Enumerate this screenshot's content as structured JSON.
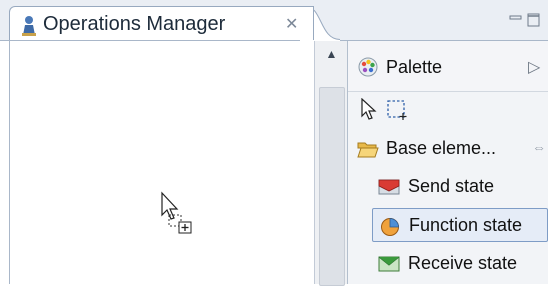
{
  "tab": {
    "title": "Operations Manager",
    "icon": "person-icon",
    "close_glyph": "✕"
  },
  "window_controls": [
    "minimize-icon",
    "maximize-icon"
  ],
  "scrollbar": {
    "up_glyph": "▲"
  },
  "palette": {
    "title": "Palette",
    "icon": "palette-icon",
    "collapse_glyph": "▷",
    "tools": [
      "select-arrow-icon",
      "marquee-select-icon"
    ],
    "drawer": {
      "label": "Base eleme...",
      "icon": "folder-open-icon",
      "pin_glyph": "⇔"
    },
    "entries": [
      {
        "label": "Send state",
        "icon": "send-state-icon",
        "selected": false
      },
      {
        "label": "Function state",
        "icon": "function-state-icon",
        "selected": true
      },
      {
        "label": "Receive state",
        "icon": "receive-state-icon",
        "selected": false
      }
    ]
  },
  "colors": {
    "tab_bar": "#eaeef4",
    "selection_border": "#7e9cc6",
    "selection_fill": "#e5ecf7"
  }
}
